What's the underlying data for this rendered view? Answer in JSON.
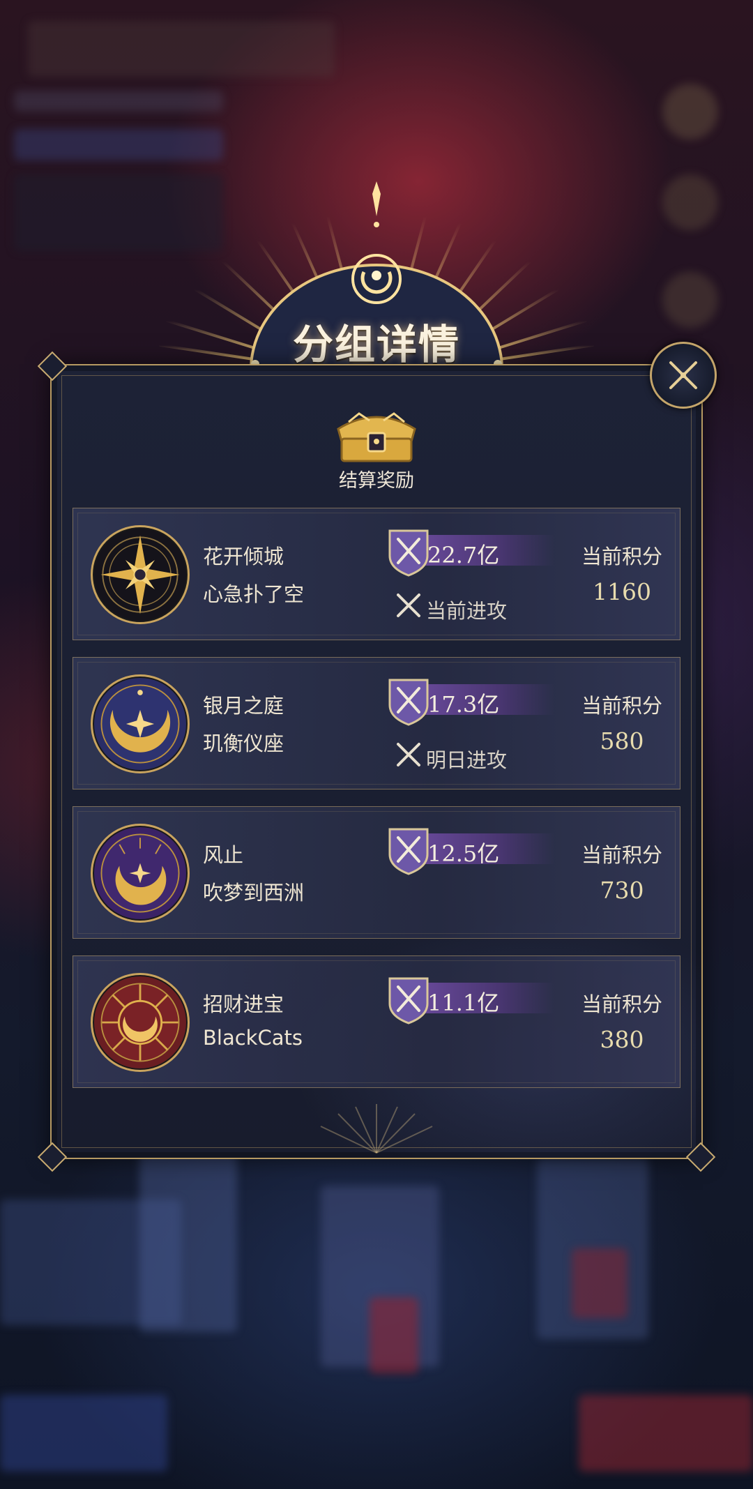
{
  "dialog": {
    "title": "分组详情",
    "reward_label": "结算奖励",
    "close_icon": "close-x-icon"
  },
  "colors": {
    "gold": "#c9a45e",
    "panel": "#1b1f31",
    "power_bar": "#6a4a9c"
  },
  "groups": [
    {
      "guild": "花开倾城",
      "player": "心急扑了空",
      "power": "22.7亿",
      "status": "当前进攻",
      "score_label": "当前积分",
      "score": "1160",
      "emblem": "compass-star-emblem"
    },
    {
      "guild": "银月之庭",
      "player": "玑衡仪座",
      "power": "17.3亿",
      "status": "明日进攻",
      "score_label": "当前积分",
      "score": "580",
      "emblem": "crescent-star-emblem"
    },
    {
      "guild": "风止",
      "player": "吹梦到西洲",
      "power": "12.5亿",
      "status": "",
      "score_label": "当前积分",
      "score": "730",
      "emblem": "sun-moon-emblem"
    },
    {
      "guild": "招财进宝",
      "player": "BlackCats",
      "power": "11.1亿",
      "status": "",
      "score_label": "当前积分",
      "score": "380",
      "emblem": "radiant-moon-emblem"
    }
  ]
}
